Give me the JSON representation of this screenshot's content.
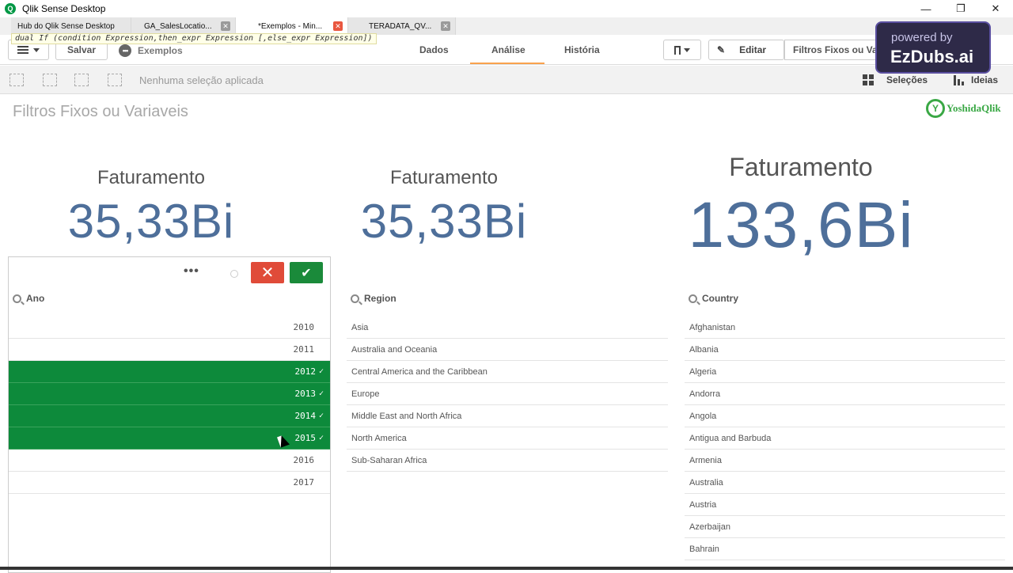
{
  "window": {
    "title": "Qlik Sense Desktop",
    "app_glyph": "Q"
  },
  "tabs": [
    {
      "label": "Hub do Qlik Sense Desktop",
      "active": false,
      "closable": false
    },
    {
      "label": "GA_SalesLocatio...",
      "active": false,
      "closable": true
    },
    {
      "label": "*Exemplos - Min...",
      "active": true,
      "closable": true
    },
    {
      "label": "TERADATA_QV...",
      "active": false,
      "closable": true
    }
  ],
  "expression_tooltip": "dual If (condition Expression,then_expr Expression [,else_expr Expression])",
  "toolbar": {
    "save_label": "Salvar",
    "app_name": "Exemplos",
    "nav": [
      "Dados",
      "Análise",
      "História"
    ],
    "edit_label": "Editar",
    "sheet_name": "Filtros Fixos ou Variaveis"
  },
  "watermark": {
    "line1": "powered by",
    "line2": "EzDubs.ai"
  },
  "selection_bar": {
    "status": "Nenhuma seleção aplicada",
    "selections_label": "Seleções",
    "insights_label": "Ideias"
  },
  "sheet": {
    "title": "Filtros Fixos ou Variaveis",
    "logo_text": "YoshidaQlik"
  },
  "kpis": [
    {
      "title": "Faturamento",
      "value": "35,33Bi"
    },
    {
      "title": "Faturamento",
      "value": "35,33Bi"
    },
    {
      "title": "Faturamento",
      "value": "133,6Bi"
    }
  ],
  "filters": {
    "ano": {
      "header": "Ano",
      "items": [
        {
          "value": "2010",
          "selected": false
        },
        {
          "value": "2011",
          "selected": false
        },
        {
          "value": "2012",
          "selected": true
        },
        {
          "value": "2013",
          "selected": true
        },
        {
          "value": "2014",
          "selected": true
        },
        {
          "value": "2015",
          "selected": true
        },
        {
          "value": "2016",
          "selected": false
        },
        {
          "value": "2017",
          "selected": false
        }
      ],
      "more_glyph": "•••",
      "cancel_glyph": "✕",
      "confirm_glyph": "✔"
    },
    "region": {
      "header": "Region",
      "items": [
        "Asia",
        "Australia and Oceania",
        "Central America and the Caribbean",
        "Europe",
        "Middle East and North Africa",
        "North America",
        "Sub-Saharan Africa"
      ]
    },
    "country": {
      "header": "Country",
      "items": [
        "Afghanistan",
        "Albania",
        "Algeria",
        "Andorra",
        "Angola",
        "Antigua and Barbuda",
        "Armenia",
        "Australia",
        "Austria",
        "Azerbaijan",
        "Bahrain"
      ]
    }
  },
  "colors": {
    "selected": "#0d8a3b",
    "kpi": "#4e6f9a",
    "accent": "#f9a24d"
  }
}
